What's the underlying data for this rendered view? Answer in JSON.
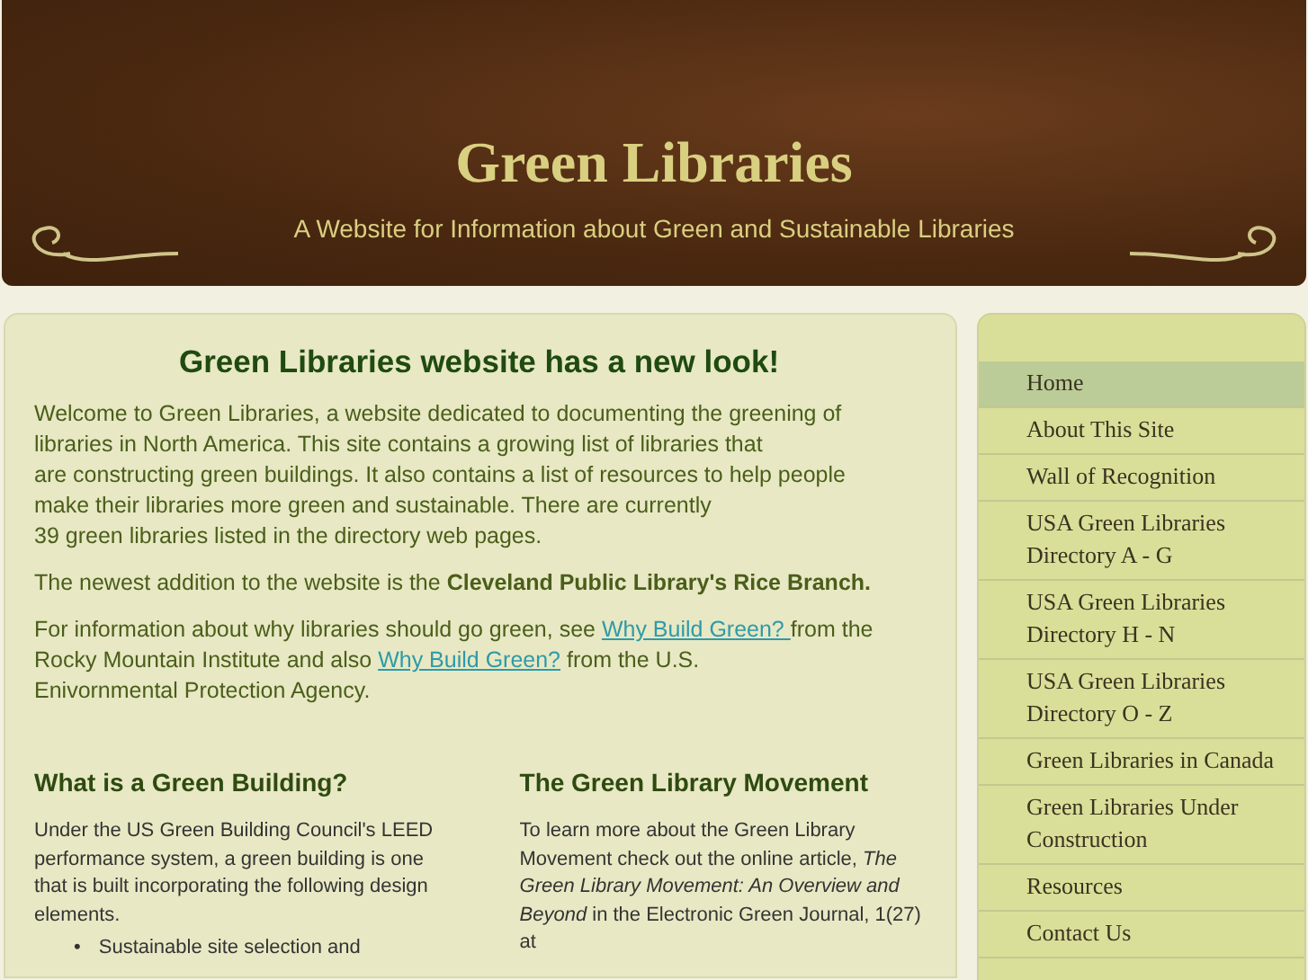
{
  "header": {
    "title": "Green Libraries",
    "tagline": "A Website for Information about Green and Sustainable Libraries"
  },
  "main": {
    "heading": "Green Libraries website has a new look!",
    "intro_lines": [
      "Welcome to Green Libraries, a website dedicated to documenting the greening of",
      "libraries in North America. This site contains a growing list of libraries that",
      "are constructing green buildings.  It also contains a list of resources to help people",
      "make their libraries more green and sustainable.  There are currently",
      "39 green libraries listed in the directory web pages."
    ],
    "newest": "The newest addition to the website is the **Cleveland Public Library's Rice Branch.**",
    "why": [
      {
        "kind": "text",
        "text": "For information about why libraries should go green, see "
      },
      {
        "kind": "link",
        "text": "Why Build Green? "
      },
      {
        "kind": "text",
        "text": "from the Rocky Mountain Institute and also "
      },
      {
        "kind": "link",
        "text": "Why Build Green?"
      },
      {
        "kind": "text",
        "text": " from the U.S."
      },
      {
        "kind": "break"
      },
      {
        "kind": "text",
        "text": "Enivornmental Protection Agency."
      }
    ],
    "columns": [
      {
        "heading": "What is a Green Building?",
        "text": "Under the US Green Building Council's LEED performance system, a green building is one that is built incorporating the following design elements.",
        "bullets": [
          {
            "marker": "•",
            "text": "Sustainable site selection and"
          }
        ]
      },
      {
        "heading": "The Green Library Movement",
        "text": "To learn more about the Green Library Movement check out the online article, *The Green Library Movement: An Overview and Beyond* in the Electronic Green Journal, 1(27) at"
      }
    ]
  },
  "sidebar": {
    "items": [
      {
        "label": "Home",
        "selected": true
      },
      {
        "label": "About This Site",
        "selected": false
      },
      {
        "label": "Wall of Recognition",
        "selected": false
      },
      {
        "label": "USA Green Libraries Directory A - G",
        "selected": false
      },
      {
        "label": "USA Green Libraries Directory H - N",
        "selected": false
      },
      {
        "label": "USA Green Libraries Directory O - Z",
        "selected": false
      },
      {
        "label": "Green Libraries in Canada",
        "selected": false
      },
      {
        "label": "Green Libraries Under Construction",
        "selected": false
      },
      {
        "label": "Resources",
        "selected": false
      },
      {
        "label": "Contact Us",
        "selected": false
      }
    ]
  }
}
